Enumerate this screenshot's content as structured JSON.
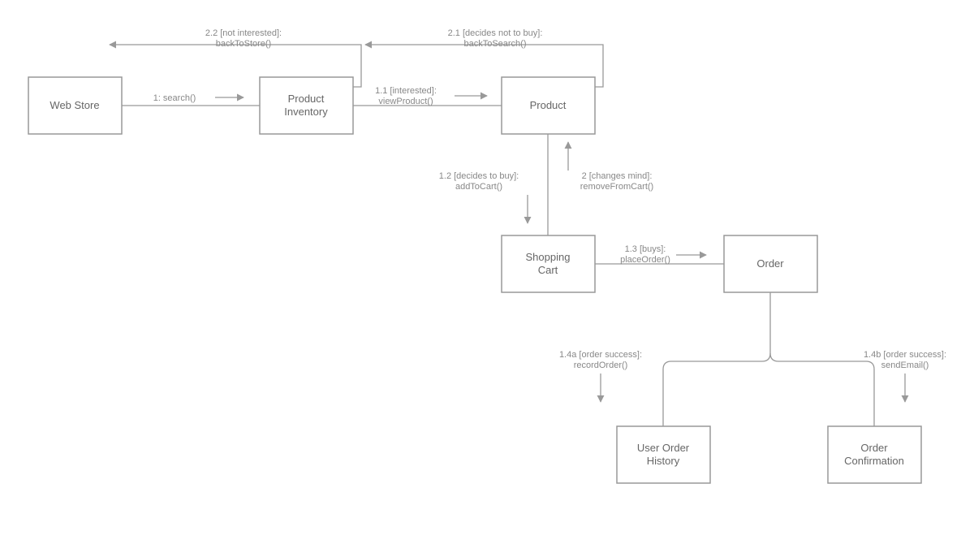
{
  "nodes": {
    "web_store": "Web Store",
    "product_inventory_l1": "Product",
    "product_inventory_l2": "Inventory",
    "product": "Product",
    "shopping_cart_l1": "Shopping",
    "shopping_cart_l2": "Cart",
    "order": "Order",
    "user_order_history_l1": "User Order",
    "user_order_history_l2": "History",
    "order_confirmation_l1": "Order",
    "order_confirmation_l2": "Confirmation"
  },
  "edges": {
    "search": "1: search()",
    "view_product_l1": "1.1 [interested]:",
    "view_product_l2": "viewProduct()",
    "back_to_store_l1": "2.2 [not interested]:",
    "back_to_store_l2": "backToStore()",
    "back_to_search_l1": "2.1 [decides not to buy]:",
    "back_to_search_l2": "backToSearch()",
    "add_to_cart_l1": "1.2 [decides to buy]:",
    "add_to_cart_l2": "addToCart()",
    "remove_from_cart_l1": "2 [changes mind]:",
    "remove_from_cart_l2": "removeFromCart()",
    "place_order_l1": "1.3 [buys]:",
    "place_order_l2": "placeOrder()",
    "record_order_l1": "1.4a [order success]:",
    "record_order_l2": "recordOrder()",
    "send_email_l1": "1.4b [order success]:",
    "send_email_l2": "sendEmail()"
  }
}
